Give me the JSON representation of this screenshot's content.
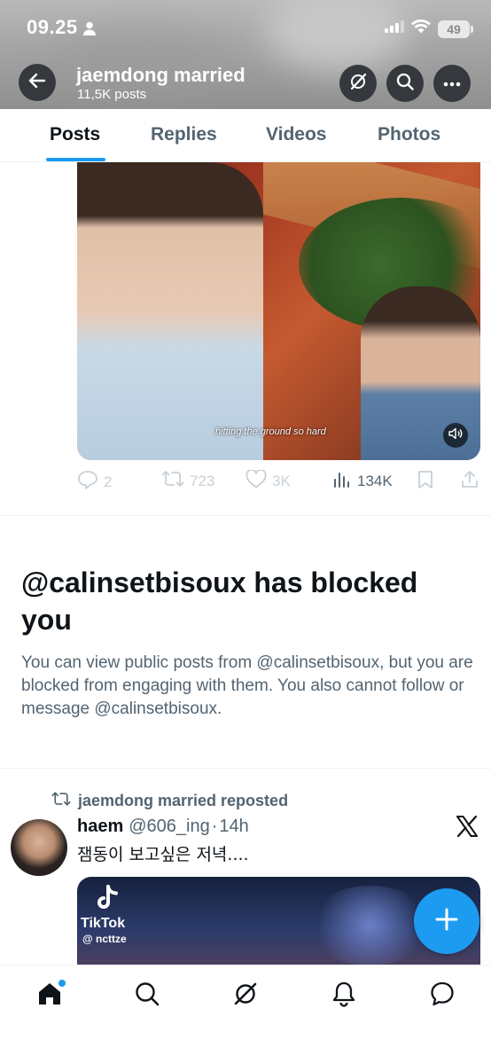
{
  "status_bar": {
    "time": "09.25",
    "battery": "49"
  },
  "header": {
    "name": "jaemdong married",
    "posts_count": "11,5K posts"
  },
  "tabs": [
    {
      "label": "Posts",
      "active": true
    },
    {
      "label": "Replies",
      "active": false
    },
    {
      "label": "Videos",
      "active": false
    },
    {
      "label": "Photos",
      "active": false
    }
  ],
  "tweet1": {
    "video_caption": "hitting the ground so hard",
    "replies": "2",
    "reposts": "723",
    "likes": "3K",
    "views": "134K"
  },
  "blocked": {
    "title": "@calinsetbisoux has blocked you",
    "description": "You can view public posts from @calinsetbisoux, but you are blocked from engaging with them. You also cannot follow or message @calinsetbisoux."
  },
  "tweet2": {
    "repost_label": "jaemdong married reposted",
    "name": "haem",
    "handle": "@606_ing",
    "dot": "·",
    "time": "14h",
    "text": "잼동이 보고싶은 저녁....",
    "tiktok_name": "TikTok",
    "tiktok_handle": "@ ncttze"
  },
  "colors": {
    "accent": "#1d9bf0",
    "text_primary": "#0f1419",
    "text_secondary": "#536471"
  }
}
